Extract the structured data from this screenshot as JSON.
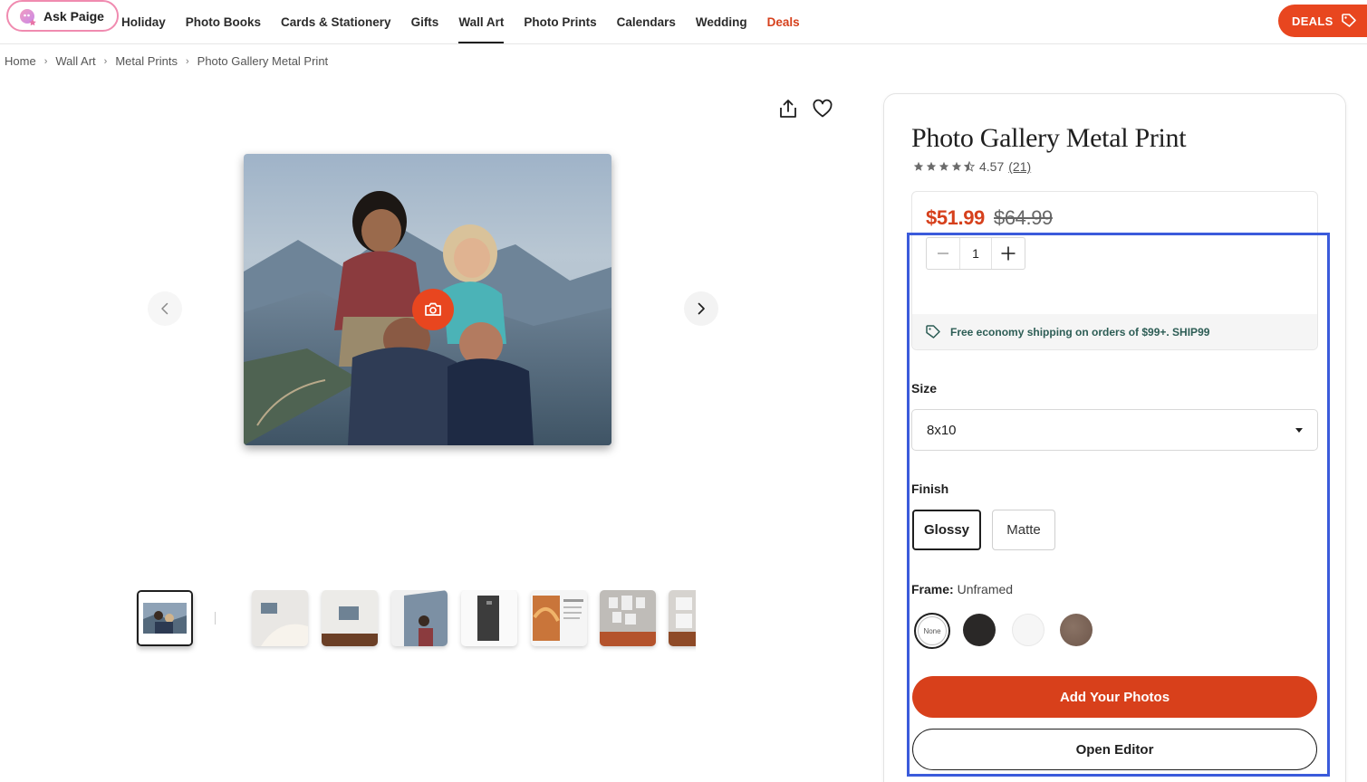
{
  "nav": {
    "ask_paige": "Ask Paige",
    "links": [
      "Holiday",
      "Photo Books",
      "Cards & Stationery",
      "Gifts",
      "Wall Art",
      "Photo Prints",
      "Calendars",
      "Wedding",
      "Deals"
    ],
    "active_link": "Wall Art",
    "deals_button": "DEALS"
  },
  "breadcrumb": [
    "Home",
    "Wall Art",
    "Metal Prints",
    "Photo Gallery Metal Print"
  ],
  "product": {
    "title": "Photo Gallery Metal Print",
    "rating": "4.57",
    "rating_stars": 4.5,
    "review_count": "(21)",
    "price_sale": "$51.99",
    "price_original": "$64.99",
    "quantity": "1",
    "shipping_note": "Free economy shipping on orders of $99+. SHIP99",
    "size_label": "Size",
    "size_value": "8x10",
    "finish_label": "Finish",
    "finish_options": [
      "Glossy",
      "Matte"
    ],
    "finish_selected": "Glossy",
    "frame_label": "Frame:",
    "frame_value": "Unframed",
    "frame_swatches": [
      {
        "name": "None",
        "color": "#ffffff"
      },
      {
        "name": "Black",
        "color": "#2a2827"
      },
      {
        "name": "White",
        "color": "#f6f6f6"
      },
      {
        "name": "Walnut",
        "color": "#7a6356"
      }
    ],
    "add_photos_button": "Add Your Photos",
    "open_editor_button": "Open Editor"
  },
  "colors": {
    "accent": "#d8401b",
    "deals_badge": "#e8461f",
    "shipping_text": "#2d5d55",
    "highlight": "#3b5bdb"
  },
  "icons": [
    "paige-icon",
    "tag-icon",
    "share-icon",
    "heart-icon",
    "camera-icon",
    "chevron-left-icon",
    "chevron-right-icon",
    "minus-icon",
    "plus-icon",
    "caret-down-icon",
    "star-icon"
  ]
}
